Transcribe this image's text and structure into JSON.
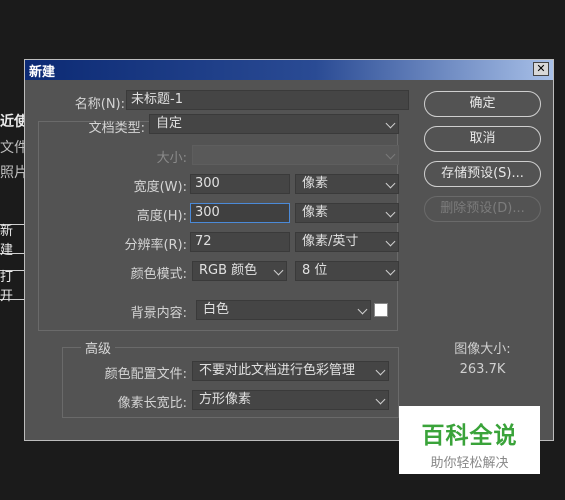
{
  "background": {
    "lines": [
      "近使",
      "文件",
      "照片"
    ],
    "buttons": [
      "新建",
      "打开"
    ]
  },
  "dialog": {
    "title": "新建",
    "close_symbol": "✕",
    "name_label": "名称(N):",
    "name_value": "未标题-1",
    "preset_label": "文档类型:",
    "preset_value": "自定",
    "size_label": "大小:",
    "size_value": "",
    "width_label": "宽度(W):",
    "width_value": "300",
    "width_unit": "像素",
    "height_label": "高度(H):",
    "height_value": "300",
    "height_unit": "像素",
    "resolution_label": "分辨率(R):",
    "resolution_value": "72",
    "resolution_unit": "像素/英寸",
    "colormode_label": "颜色模式:",
    "colormode_value": "RGB 颜色",
    "bitdepth_value": "8 位",
    "bg_label": "背景内容:",
    "bg_value": "白色",
    "advanced_title": "高级",
    "profile_label": "颜色配置文件:",
    "profile_value": "不要对此文档进行色彩管理",
    "pixel_aspect_label": "像素长宽比:",
    "pixel_aspect_value": "方形像素",
    "buttons": {
      "ok": "确定",
      "cancel": "取消",
      "save_preset": "存储预设(S)...",
      "delete_preset": "删除预设(D)..."
    },
    "image_size_label": "图像大小:",
    "image_size_value": "263.7K"
  },
  "watermark": {
    "logo": "百科全说",
    "tagline": "助你轻松解决"
  },
  "colors": {
    "dialog_bg": "#535353",
    "title_gradient_start": "#0c2a74",
    "focus_border": "#4b8ad8"
  }
}
